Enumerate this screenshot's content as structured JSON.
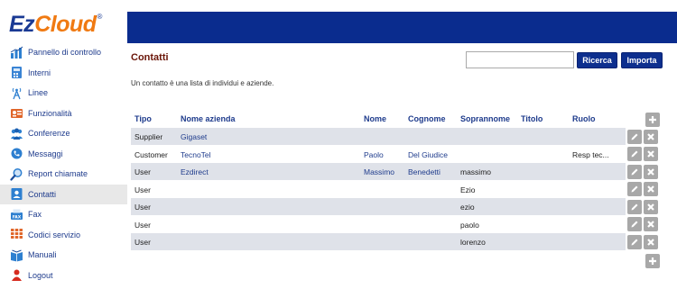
{
  "brand": {
    "part1": "Ez",
    "part2": "Cloud",
    "reg": "®"
  },
  "sidebar": {
    "items": [
      {
        "label": "Pannello di controllo",
        "icon": "dashboard-chart-icon"
      },
      {
        "label": "Interni",
        "icon": "phone-directory-icon"
      },
      {
        "label": "Linee",
        "icon": "antenna-line-icon"
      },
      {
        "label": "Funzionalità",
        "icon": "features-icon"
      },
      {
        "label": "Conferenze",
        "icon": "conference-users-icon"
      },
      {
        "label": "Messaggi",
        "icon": "voicemail-phone-icon"
      },
      {
        "label": "Report chiamate",
        "icon": "magnifier-report-icon"
      },
      {
        "label": "Contatti",
        "icon": "contacts-icon",
        "active": true
      },
      {
        "label": "Fax",
        "icon": "fax-icon"
      },
      {
        "label": "Codici servizio",
        "icon": "keypad-icon"
      },
      {
        "label": "Manuali",
        "icon": "manuals-book-icon"
      },
      {
        "label": "Logout",
        "icon": "logout-user-icon"
      }
    ]
  },
  "main": {
    "title": "Contatti",
    "description": "Un contatto è una lista di individui e aziende.",
    "search": {
      "value": "",
      "placeholder": ""
    },
    "search_button": "Ricerca",
    "import_button": "Importa"
  },
  "table": {
    "headers": {
      "tipo": "Tipo",
      "azienda": "Nome azienda",
      "nome": "Nome",
      "cognome": "Cognome",
      "soprannome": "Soprannome",
      "titolo": "Titolo",
      "ruolo": "Ruolo"
    },
    "rows": [
      {
        "tipo": "Supplier",
        "azienda": "Gigaset",
        "nome": "",
        "cognome": "",
        "soprannome": "",
        "titolo": "",
        "ruolo": ""
      },
      {
        "tipo": "Customer",
        "azienda": "TecnoTel",
        "nome": "Paolo",
        "cognome": "Del Giudice",
        "soprannome": "",
        "titolo": "",
        "ruolo": "Resp tec..."
      },
      {
        "tipo": "User",
        "azienda": "Ezdirect",
        "nome": "Massimo",
        "cognome": "Benedetti",
        "soprannome": "massimo",
        "titolo": "",
        "ruolo": ""
      },
      {
        "tipo": "User",
        "azienda": "",
        "nome": "",
        "cognome": "",
        "soprannome": "Ezio",
        "titolo": "",
        "ruolo": ""
      },
      {
        "tipo": "User",
        "azienda": "",
        "nome": "",
        "cognome": "",
        "soprannome": "ezio",
        "titolo": "",
        "ruolo": ""
      },
      {
        "tipo": "User",
        "azienda": "",
        "nome": "",
        "cognome": "",
        "soprannome": "paolo",
        "titolo": "",
        "ruolo": ""
      },
      {
        "tipo": "User",
        "azienda": "",
        "nome": "",
        "cognome": "",
        "soprannome": "lorenzo",
        "titolo": "",
        "ruolo": ""
      }
    ]
  },
  "colors": {
    "header_bar": "#0a2c8e",
    "title": "#6a1508",
    "link": "#1e3b8c",
    "row_shade": "#dfe2e9",
    "icon_button": "#a8a8a8"
  }
}
